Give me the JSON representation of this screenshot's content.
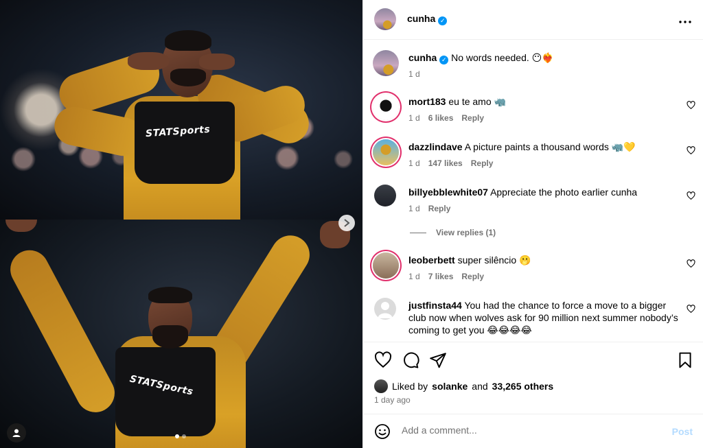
{
  "header": {
    "username": "cunha",
    "verified_icon": "verified-badge-icon",
    "more_icon": "more-options-icon"
  },
  "caption": {
    "username": "cunha",
    "text": "No words needed. 😶❤️‍🔥",
    "time": "1 d"
  },
  "comments": [
    {
      "username": "mort183",
      "text": "eu te amo 🦏",
      "time": "1 d",
      "likes": "6 likes",
      "reply": "Reply"
    },
    {
      "username": "dazzlindave",
      "text": "A picture paints a thousand words 🦏💛",
      "time": "1 d",
      "likes": "147 likes",
      "reply": "Reply"
    },
    {
      "username": "billyebblewhite07",
      "text": "Appreciate the photo earlier cunha",
      "time": "1 d",
      "reply": "Reply",
      "view_replies": "View replies (1)"
    },
    {
      "username": "leoberbett",
      "text": "super silêncio 🫢",
      "time": "1 d",
      "likes": "7 likes",
      "reply": "Reply"
    },
    {
      "username": "justfinsta44",
      "text": "You had the chance to force a move to a bigger club now when wolves ask for 90 million next summer nobody’s coming to get you 😂😂😂😂"
    }
  ],
  "actions": {
    "liked_by_prefix": "Liked by",
    "liked_by_user": "solanke",
    "liked_by_and": "and",
    "liked_by_others": "33,265 others",
    "posted_ago": "1 day ago"
  },
  "add_comment": {
    "placeholder": "Add a comment...",
    "post_label": "Post"
  },
  "media": {
    "vest_logo": "STATSports",
    "carousel": {
      "count": 2,
      "active": 1
    }
  },
  "colors": {
    "accent": "#0095f6",
    "post_disabled": "#b3dbff",
    "muted_text": "#737373",
    "shirt": "#d9a126"
  }
}
